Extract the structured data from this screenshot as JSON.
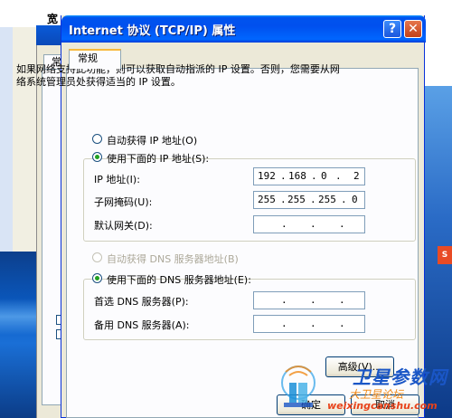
{
  "background": {
    "behind_window_title": "宽",
    "behind_tab_label": "常",
    "side_badge": "S"
  },
  "dialog": {
    "title": "Internet 协议 (TCP/IP) 属性",
    "help_label": "?",
    "close_label": "✕",
    "tab_label": "常规",
    "intro_text": "如果网络支持此功能，则可以获取自动指派的 IP 设置。否则，您需要从网络系统管理员处获得适当的 IP 设置。",
    "ip_section": {
      "auto_option": "自动获得 IP 地址(O)",
      "manual_option": "使用下面的 IP 地址(S):",
      "selected": "manual",
      "fields": [
        {
          "label": "IP 地址(I):",
          "octets": [
            "192",
            "168",
            "0",
            "2"
          ]
        },
        {
          "label": "子网掩码(U):",
          "octets": [
            "255",
            "255",
            "255",
            "0"
          ]
        },
        {
          "label": "默认网关(D):",
          "octets": [
            "",
            "",
            "",
            ""
          ]
        }
      ]
    },
    "dns_section": {
      "auto_option": "自动获得 DNS 服务器地址(B)",
      "manual_option": "使用下面的 DNS 服务器地址(E):",
      "selected": "manual",
      "fields": [
        {
          "label": "首选 DNS 服务器(P):",
          "octets": [
            "",
            "",
            "",
            ""
          ]
        },
        {
          "label": "备用 DNS 服务器(A):",
          "octets": [
            "",
            "",
            "",
            ""
          ]
        }
      ]
    },
    "advanced_button": "高级(V)...",
    "ok_button": "确定",
    "cancel_button": "取消"
  },
  "watermark": {
    "name": "卫星参数网",
    "subtitle": "大卫星论坛",
    "url": "weixingcanshu.com"
  },
  "colors": {
    "titlebar": "#0053ee",
    "dialog_face": "#ece9d8",
    "panel": "#fcfcfe",
    "radio_dot": "#21a121",
    "watermark_blue": "#1a56c6",
    "watermark_orange": "#f08a18"
  }
}
